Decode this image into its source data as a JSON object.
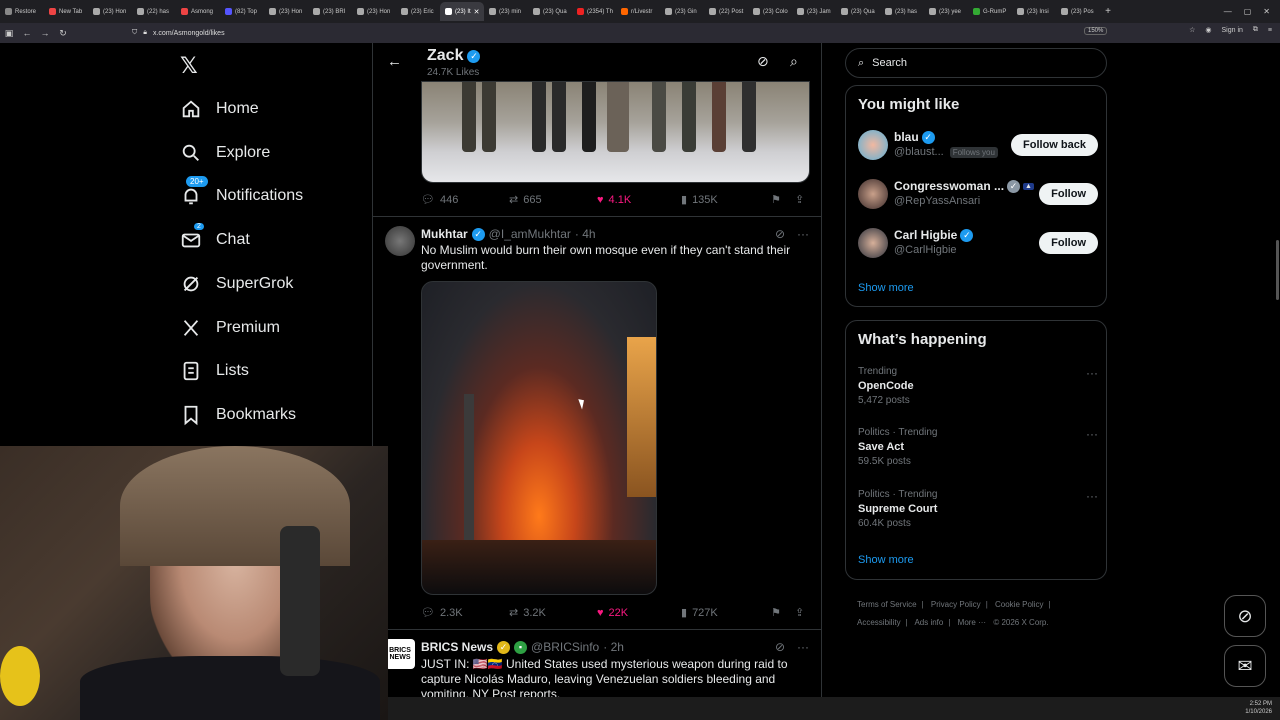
{
  "browser": {
    "tabs": [
      {
        "label": "Restore"
      },
      {
        "label": "New Tab"
      },
      {
        "label": "(23) Hon"
      },
      {
        "label": "(22) has"
      },
      {
        "label": "Asmong"
      },
      {
        "label": "(82) Top"
      },
      {
        "label": "(23) Hon"
      },
      {
        "label": "(23) BRI"
      },
      {
        "label": "(23) Hon"
      },
      {
        "label": "(23) Eric"
      },
      {
        "label": "(23) It"
      },
      {
        "label": "(23) min"
      },
      {
        "label": "(23) Qua"
      },
      {
        "label": "(2354) Th"
      },
      {
        "label": "r/Livestr"
      },
      {
        "label": "(23) Gin"
      },
      {
        "label": "(22) Post"
      },
      {
        "label": "(23) Colo"
      },
      {
        "label": "(23) Jam"
      },
      {
        "label": "(23) Qua"
      },
      {
        "label": "(23) has"
      },
      {
        "label": "(23) yee"
      },
      {
        "label": "G-RumP"
      },
      {
        "label": "(23) Insi"
      },
      {
        "label": "(23) Pos"
      }
    ],
    "active_tab_index": 10,
    "url": "x.com/Asmongold/likes",
    "zoom": "150%",
    "sign_in": "Sign in"
  },
  "sidebar": {
    "items": [
      {
        "label": "Home",
        "icon": "home-icon"
      },
      {
        "label": "Explore",
        "icon": "search-icon"
      },
      {
        "label": "Notifications",
        "icon": "bell-icon",
        "badge": "20+"
      },
      {
        "label": "Chat",
        "icon": "mail-icon",
        "badge": "2"
      },
      {
        "label": "SuperGrok",
        "icon": "grok-icon"
      },
      {
        "label": "Premium",
        "icon": "x-icon"
      },
      {
        "label": "Lists",
        "icon": "list-icon"
      },
      {
        "label": "Bookmarks",
        "icon": "bookmark-icon"
      }
    ]
  },
  "header": {
    "name": "Zack",
    "sub": "24.7K Likes"
  },
  "post1": {
    "replies": "446",
    "reposts": "665",
    "likes": "4.1K",
    "views": "135K"
  },
  "post2": {
    "name": "Mukhtar",
    "handle": "@I_amMukhtar",
    "time": "· 4h",
    "text": "No Muslim would burn their own mosque even if they can't stand their government.",
    "replies": "2.3K",
    "reposts": "3.2K",
    "likes": "22K",
    "views": "727K"
  },
  "post3": {
    "name": "BRICS News",
    "handle": "@BRICSinfo",
    "time": "· 2h",
    "avatar_text": "BRICS NEWS",
    "text": "JUST IN: 🇺🇸🇻🇪 United States used mysterious weapon during raid to capture Nicolás Maduro, leaving Venezuelan soldiers bleeding and vomiting, NY Post reports."
  },
  "right": {
    "search_placeholder": "Search",
    "who_title": "You might like",
    "suggestions": [
      {
        "name": "blau",
        "handle": "@blaust...",
        "follows_you": "Follows you",
        "button": "Follow back"
      },
      {
        "name": "Congresswoman ...",
        "handle": "@RepYassAnsari",
        "button": "Follow"
      },
      {
        "name": "Carl Higbie",
        "handle": "@CarlHigbie",
        "button": "Follow"
      }
    ],
    "show_more": "Show more",
    "whats_title": "What’s happening",
    "trends": [
      {
        "context": "Trending",
        "name": "OpenCode",
        "posts": "5,472 posts"
      },
      {
        "context": "Politics · Trending",
        "name": "Save Act",
        "posts": "59.5K posts"
      },
      {
        "context": "Politics · Trending",
        "name": "Supreme Court",
        "posts": "60.4K posts"
      }
    ],
    "show_more_2": "Show more",
    "footer": [
      "Terms of Service",
      "|",
      "Privacy Policy",
      "|",
      "Cookie Policy",
      "|",
      "Accessibility",
      "|",
      "Ads info",
      "|",
      "More ···",
      "© 2026 X Corp."
    ]
  },
  "taskbar": {
    "time": "2:52 PM",
    "date": "1/10/2026"
  },
  "colors": {
    "accent": "#1d9bf0",
    "like": "#f91880",
    "border": "#2f3336"
  }
}
